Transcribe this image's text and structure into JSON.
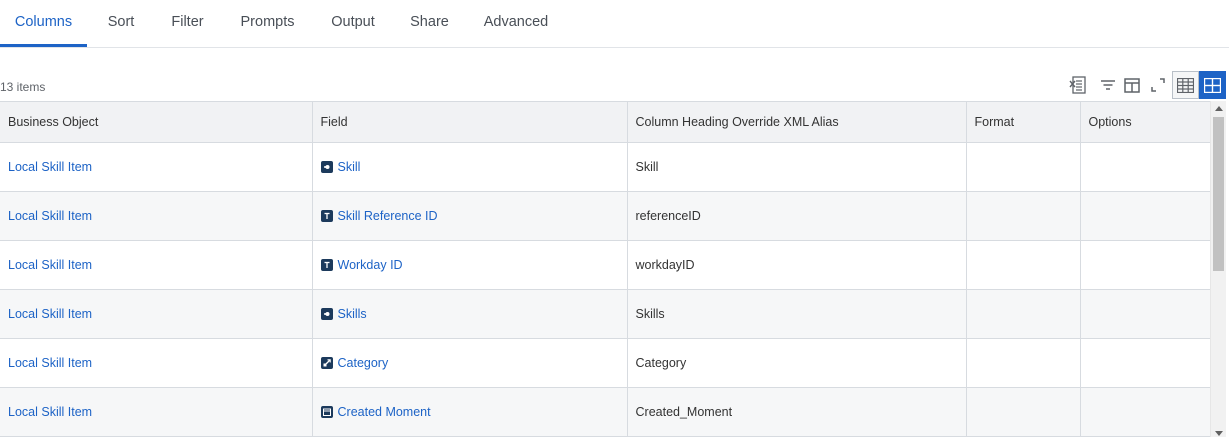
{
  "tabs": [
    {
      "label": "Columns",
      "active": true
    },
    {
      "label": "Sort",
      "active": false
    },
    {
      "label": "Filter",
      "active": false
    },
    {
      "label": "Prompts",
      "active": false
    },
    {
      "label": "Output",
      "active": false
    },
    {
      "label": "Share",
      "active": false
    },
    {
      "label": "Advanced",
      "active": false
    }
  ],
  "count_label": "13 items",
  "toolbar": {
    "icons": [
      "export-excel-icon",
      "filter-icon",
      "column-layout-icon",
      "fullscreen-icon",
      "table-view-icon",
      "grid-view-icon"
    ],
    "active_view": "grid-view-icon"
  },
  "table": {
    "headers": [
      "Business Object",
      "Field",
      "Column Heading Override XML Alias",
      "Format",
      "Options"
    ],
    "rows": [
      {
        "business_object": "Local Skill Item",
        "field": "Skill",
        "field_icon": "single-instance-icon",
        "alias": "Skill",
        "format": "",
        "options": ""
      },
      {
        "business_object": "Local Skill Item",
        "field": "Skill Reference ID",
        "field_icon": "text-icon",
        "alias": "referenceID",
        "format": "",
        "options": ""
      },
      {
        "business_object": "Local Skill Item",
        "field": "Workday ID",
        "field_icon": "text-icon",
        "alias": "workdayID",
        "format": "",
        "options": ""
      },
      {
        "business_object": "Local Skill Item",
        "field": "Skills",
        "field_icon": "single-instance-icon",
        "alias": "Skills",
        "format": "",
        "options": ""
      },
      {
        "business_object": "Local Skill Item",
        "field": "Category",
        "field_icon": "related-instance-icon",
        "alias": "Category",
        "format": "",
        "options": ""
      },
      {
        "business_object": "Local Skill Item",
        "field": "Created Moment",
        "field_icon": "date-icon",
        "alias": "Created_Moment",
        "format": "",
        "options": ""
      }
    ]
  },
  "colors": {
    "accent": "#1d63c6",
    "field_icon_bg": "#1c3a5c",
    "header_bg": "#f1f2f4",
    "alt_row_bg": "#f6f7f8"
  }
}
